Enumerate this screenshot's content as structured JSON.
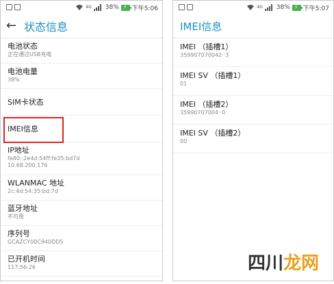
{
  "left_phone": {
    "status": {
      "battery_pct": "38%",
      "time": "下午5:06",
      "network": "4G"
    },
    "header_title": "状态信息",
    "items": [
      {
        "title": "电池状态",
        "sub": "正在通过USB充电"
      },
      {
        "title": "电池电量",
        "sub": "38%"
      },
      {
        "title": "SIM卡状态",
        "sub": ""
      },
      {
        "title": "IMEI信息",
        "sub": ""
      },
      {
        "title": "IP地址",
        "sub": "fe80::2e4d:54ff:fe35:bd7d",
        "sub2": "10.68.200.176"
      },
      {
        "title": "WLANMAC 地址",
        "sub": "2c:4d:54:35:bd:7d"
      },
      {
        "title": "蓝牙地址",
        "sub": "不可用"
      },
      {
        "title": "序列号",
        "sub": "GCAZCY00C940DD5"
      },
      {
        "title": "已开机时间",
        "sub": "117:56:26"
      }
    ]
  },
  "right_phone": {
    "status": {
      "battery_pct": "38%",
      "time": "下午5:07",
      "network": "4G"
    },
    "header_title": "IMEI信息",
    "items": [
      {
        "title": "IMEI （插槽1）",
        "sub": "359907070042··3"
      },
      {
        "title": "IMEI SV （插槽1）",
        "sub": "01"
      },
      {
        "title": "IMEI （插槽2）",
        "sub": "35990707004··0"
      },
      {
        "title": "IMEI SV （插槽2）",
        "sub": "00"
      }
    ]
  },
  "watermark": {
    "part1": "四川",
    "part2": "龙网"
  },
  "colors": {
    "accent": "#1a8fc4",
    "highlight": "#e02020",
    "battery": "#4caf50"
  }
}
